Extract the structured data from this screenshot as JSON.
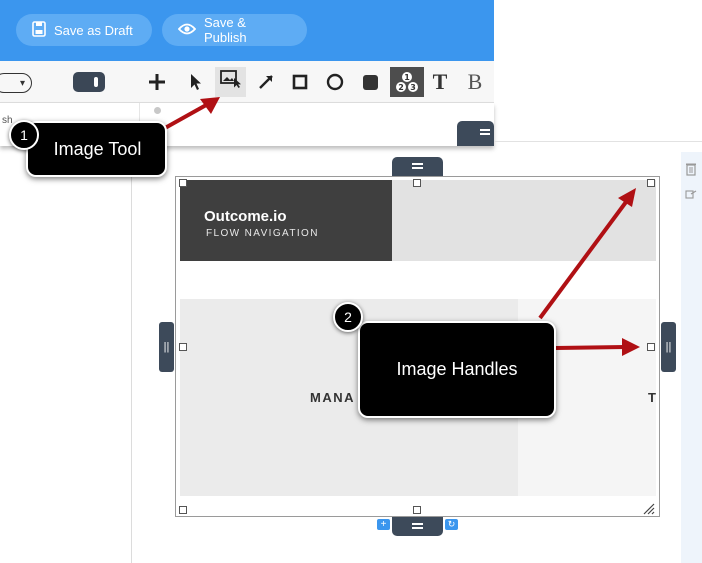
{
  "toolbar": {
    "save_draft_label": "Save as Draft",
    "save_publish_label": "Save & Publish",
    "accent_color": "#3b96ee",
    "tools": [
      "plus-icon",
      "pointer-icon",
      "image-icon",
      "line-icon",
      "square-icon",
      "circle-icon",
      "filled-square-icon",
      "numbers-icon",
      "text-icon",
      "bold-icon"
    ],
    "text_tool_label": "T",
    "bold_tool_label": "B",
    "cutoff_hint": "sh"
  },
  "image": {
    "brand_title": "Outcome.io",
    "brand_subtitle": "FLOW NAVIGATION",
    "partial_text_left": "MANA",
    "partial_text_right": "T"
  },
  "callouts": [
    {
      "number": "1",
      "label": "Image Tool"
    },
    {
      "number": "2",
      "label": "Image Handles"
    }
  ],
  "arrow_color": "#b01014"
}
